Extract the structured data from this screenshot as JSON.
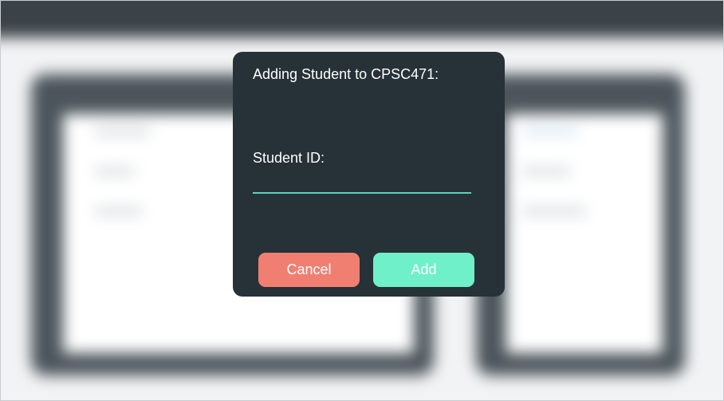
{
  "dialog": {
    "title": "Adding Student to CPSC471:",
    "field_label": "Student ID:",
    "field_value": "",
    "cancel_label": "Cancel",
    "add_label": "Add"
  },
  "colors": {
    "dialog_bg": "#263238",
    "cancel": "#f07f72",
    "add": "#6ff0c8",
    "input_underline": "#5fd0bf"
  }
}
